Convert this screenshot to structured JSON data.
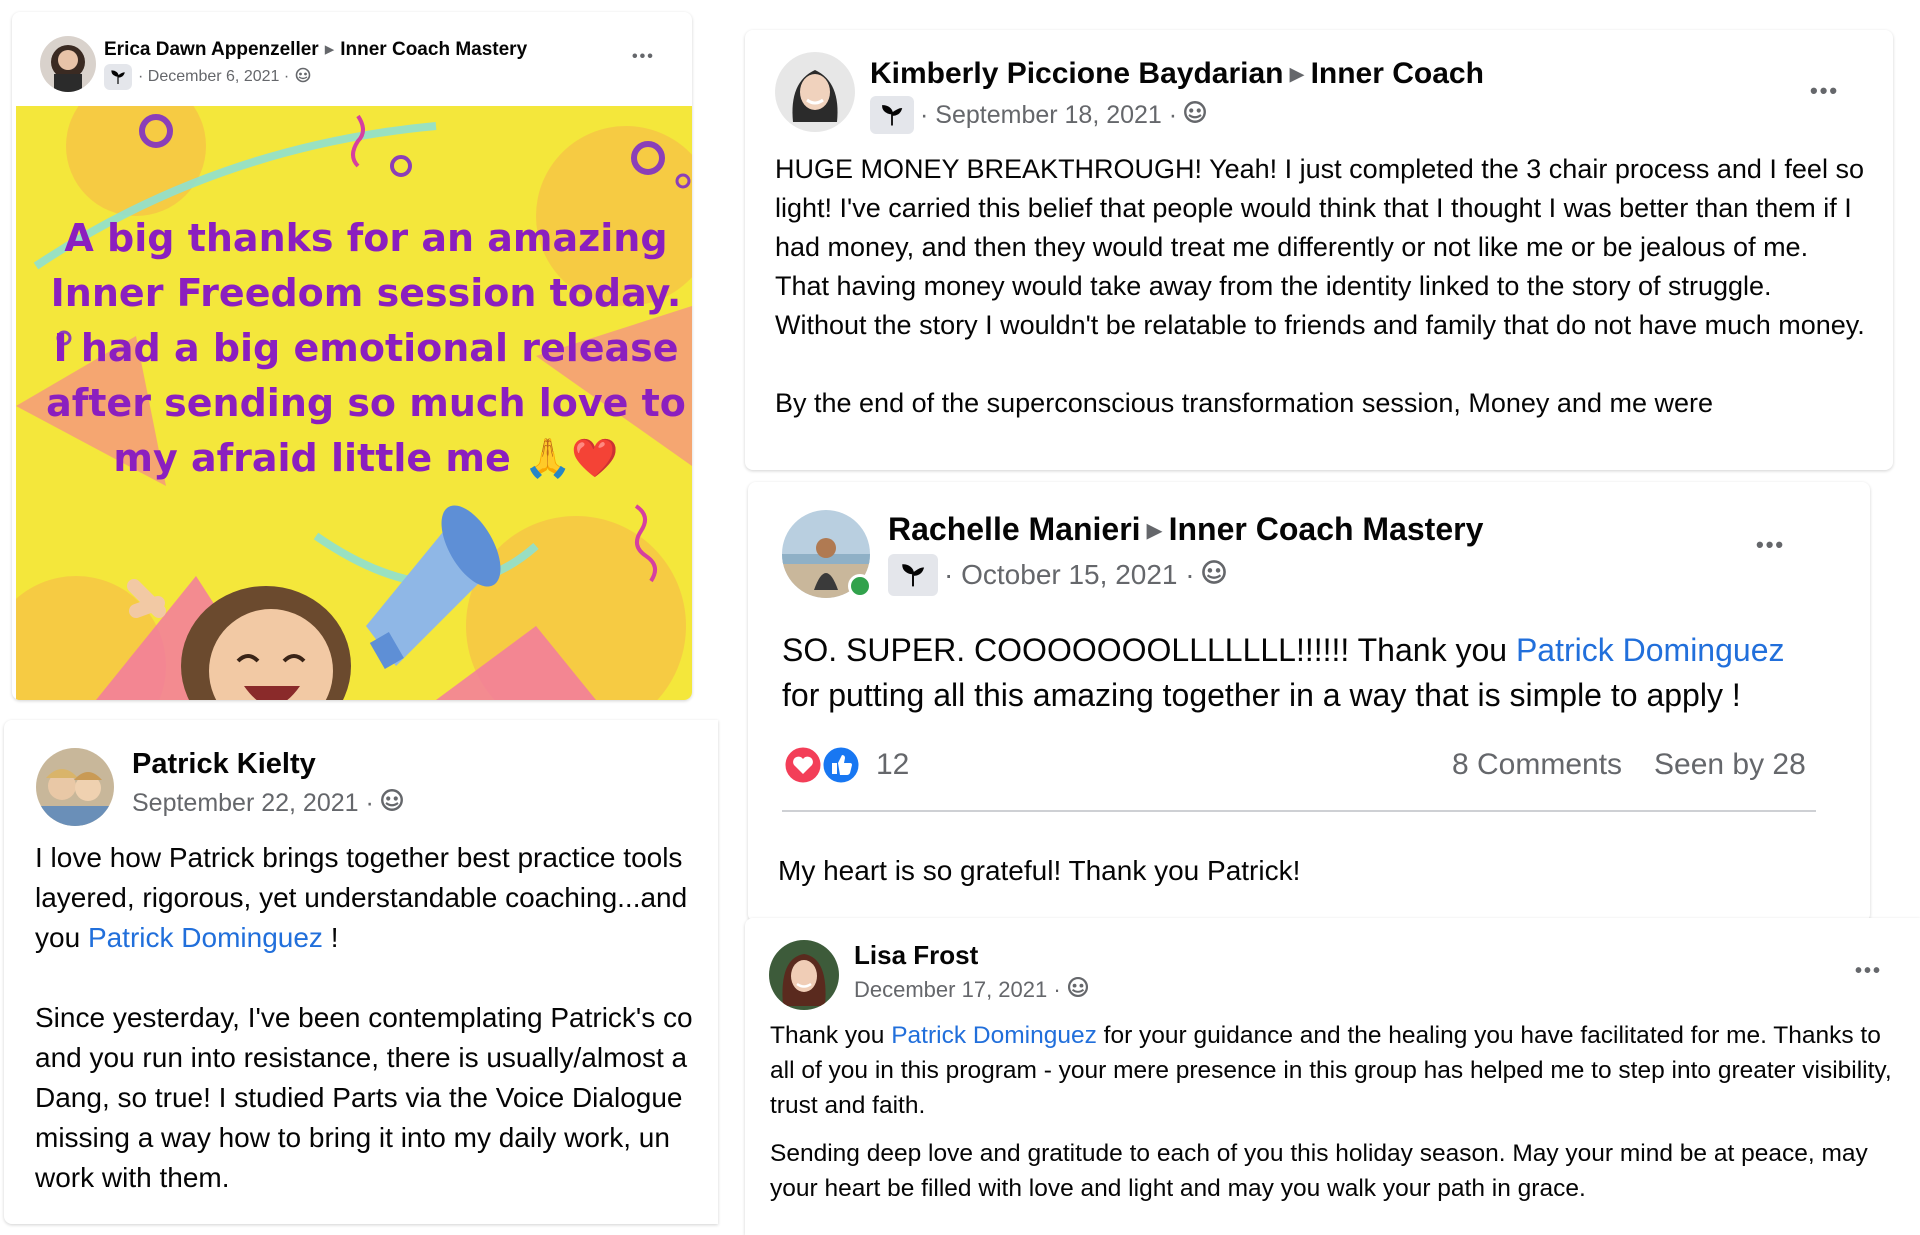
{
  "colors": {
    "link": "#216fdb",
    "banner_bg": "#f4e73b",
    "banner_text": "#8b1fbf",
    "online": "#31a24c",
    "muted": "#65676b"
  },
  "posts": {
    "erica": {
      "author": "Erica Dawn Appenzeller",
      "group": "Inner Coach Mastery",
      "date": "December 6, 2021",
      "more": "•••",
      "image_text": "A big thanks for an amazing Inner Freedom session today. I had a big emotional release after sending so much love to my afraid little me 🙏❤️"
    },
    "kimberly": {
      "author": "Kimberly Piccione Baydarian",
      "group": "Inner Coach",
      "date": "September 18, 2021",
      "more": "•••",
      "para1": "HUGE MONEY BREAKTHROUGH! Yeah! I just completed the 3 chair process and I feel so light! I've carried this belief that people would think that I thought I was better than them if I had money, and then they would treat me differently or not like me or be jealous of me. That having money would take away from the identity linked to the story of struggle. Without the story I wouldn't be  relatable to friends and family that do not have much money.",
      "para2": "By the end of the superconscious transformation session, Money and me were"
    },
    "rachelle": {
      "author": "Rachelle Manieri",
      "group": "Inner Coach Mastery",
      "date": "October 15, 2021",
      "more": "•••",
      "text_before": "SO. SUPER. COOOOOOOLLLLLLL!!!!!! Thank you ",
      "mention": "Patrick Dominguez",
      "text_after": " for putting all this amazing together in a way that is simple to apply !",
      "reaction_count": "12",
      "comments": "8 Comments",
      "seen": "Seen by 28",
      "below_text": "My heart is so grateful! Thank you Patrick!"
    },
    "patrick": {
      "author": "Patrick Kielty",
      "date": "September 22, 2021",
      "para1_before": "I love how Patrick brings together best practice tools",
      "para1_line2": "layered, rigorous, yet understandable coaching...and",
      "para1_line3_before": "you ",
      "mention": "Patrick Dominguez",
      "para1_line3_after": " !",
      "para2_lines": [
        "Since yesterday, I've been contemplating Patrick's co",
        "and you run into resistance, there is usually/almost a",
        "Dang, so true! I studied Parts via the Voice Dialogue",
        "missing a way how to bring it into my daily work, un",
        "work with them."
      ]
    },
    "lisa": {
      "author": "Lisa Frost",
      "date": "December 17, 2021",
      "more": "•••",
      "para1_before": "Thank you ",
      "mention": "Patrick Dominguez",
      "para1_after": " for your guidance and the healing you have facilitated for me. Thanks to all of you in this program - your mere presence in this group has helped me to step into greater visibility, trust and faith.",
      "para2": "Sending deep love and gratitude to each of you this holiday season. May your mind be at peace, may your heart be filled with love and light and may you walk your path in grace."
    }
  }
}
